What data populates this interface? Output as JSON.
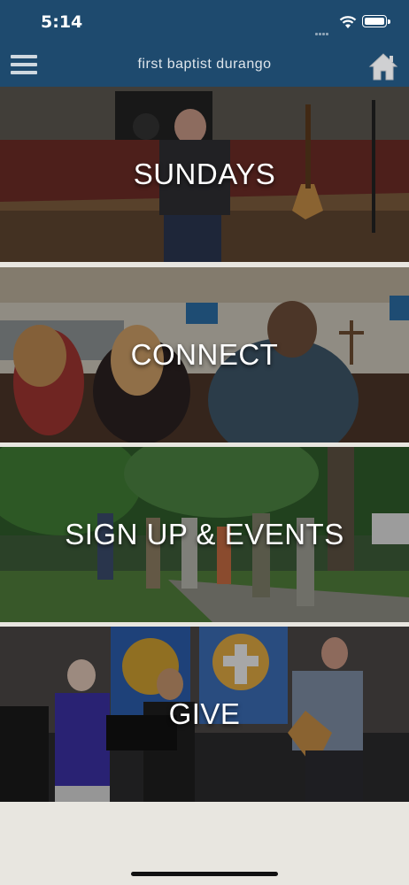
{
  "status_bar": {
    "time": "5:14"
  },
  "header": {
    "title": "first baptist durango",
    "menu_icon": "hamburger-menu-icon",
    "home_icon": "home-icon"
  },
  "tiles": [
    {
      "label": "SUNDAYS"
    },
    {
      "label": "CONNECT"
    },
    {
      "label": "SIGN UP & EVENTS"
    },
    {
      "label": "GIVE"
    }
  ],
  "colors": {
    "header_bg": "#1e4a6e",
    "page_bg": "#e8e6e0",
    "label": "#ffffff"
  }
}
